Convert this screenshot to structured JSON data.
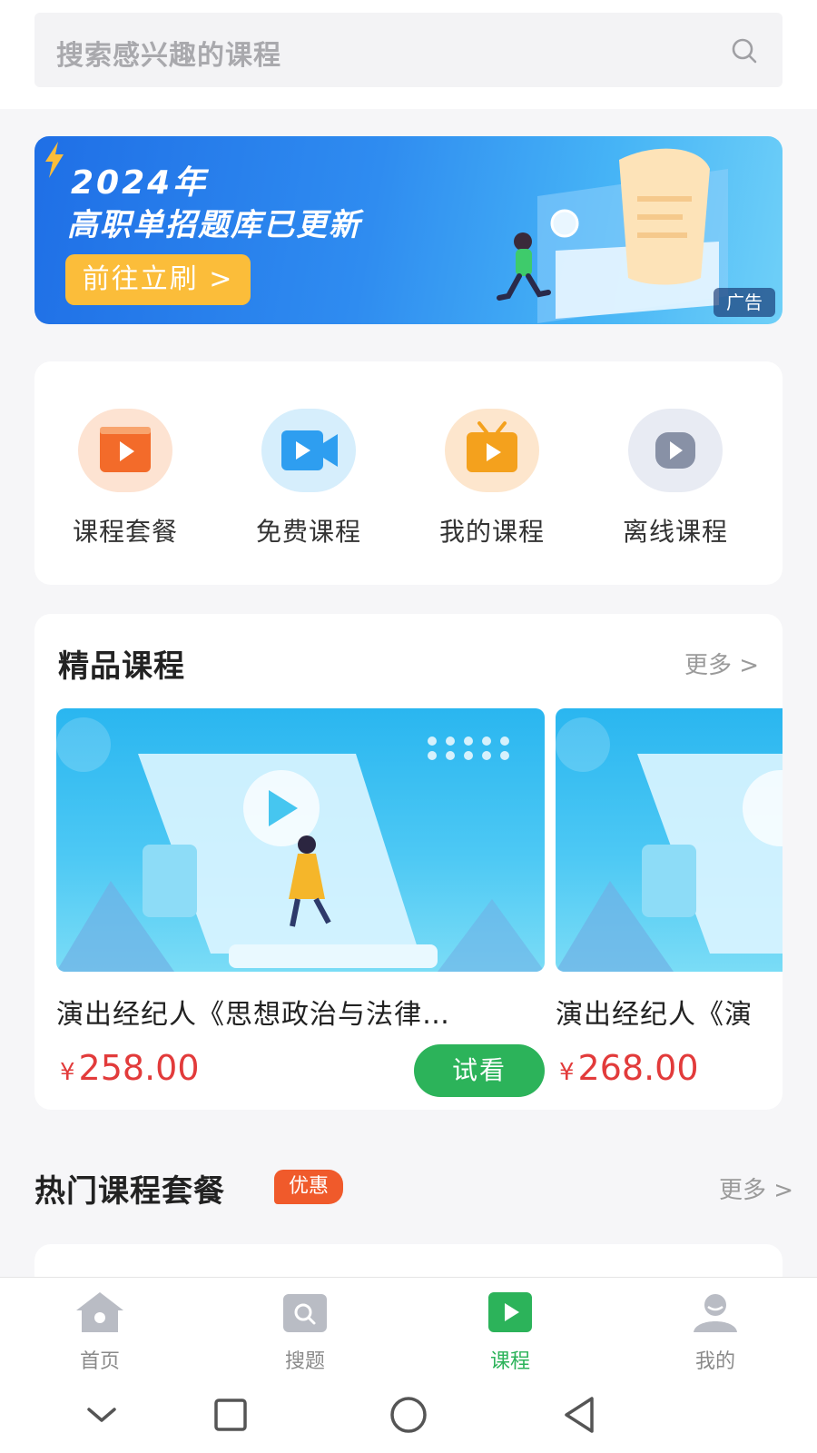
{
  "search": {
    "placeholder": "搜索感兴趣的课程"
  },
  "banner": {
    "year": "2024年",
    "title": "高职单招题库已更新",
    "button": "前往立刷 >",
    "ad_tag": "广告"
  },
  "quick_nav": [
    {
      "label": "课程套餐",
      "icon": "course-package-icon",
      "bg": "#fde3d2",
      "color": "#f36b2a"
    },
    {
      "label": "免费课程",
      "icon": "free-course-icon",
      "bg": "#d6eefc",
      "color": "#2e9ef0"
    },
    {
      "label": "我的课程",
      "icon": "my-course-icon",
      "bg": "#fde6cd",
      "color": "#f4a11d"
    },
    {
      "label": "离线课程",
      "icon": "offline-course-icon",
      "bg": "#e8ebf3",
      "color": "#8891a6"
    }
  ],
  "featured": {
    "title": "精品课程",
    "more": "更多 >",
    "courses": [
      {
        "title": "演出经纪人《思想政治与法律…",
        "currency": "¥",
        "price": "258.00",
        "action": "试看"
      },
      {
        "title": "演出经纪人《演",
        "currency": "¥",
        "price": "268.00",
        "action": ""
      }
    ]
  },
  "hot": {
    "title": "热门课程套餐",
    "badge": "优惠",
    "more": "更多 >"
  },
  "tabbar": [
    {
      "label": "首页",
      "icon": "home-icon",
      "active": false
    },
    {
      "label": "搜题",
      "icon": "search-question-icon",
      "active": false
    },
    {
      "label": "课程",
      "icon": "course-play-icon",
      "active": true
    },
    {
      "label": "我的",
      "icon": "profile-icon",
      "active": false
    }
  ],
  "colors": {
    "accent": "#2cb35a",
    "price": "#e23b3b",
    "badge": "#f05a2b"
  }
}
